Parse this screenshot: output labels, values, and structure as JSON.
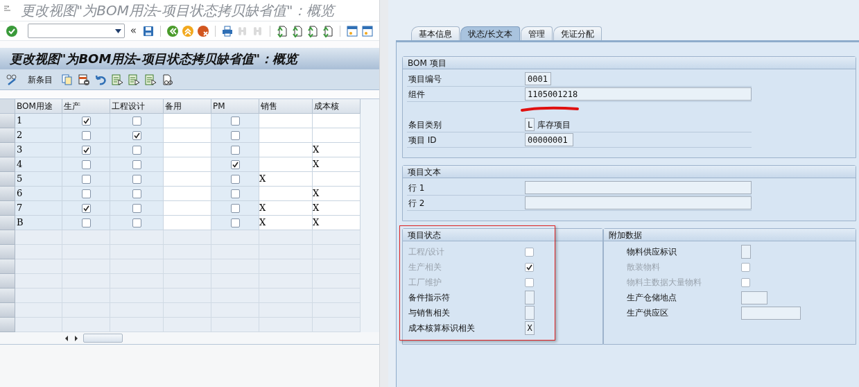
{
  "window": {
    "title": "更改视图\"为BOM用法-项目状态拷贝缺省值\"：概览"
  },
  "toolbar": {
    "back_symbol": "«"
  },
  "header": {
    "title": "更改视图\"为BOM用法-项目状态拷贝缺省值\"：概览"
  },
  "app_toolbar": {
    "new_entries": "新条目"
  },
  "table": {
    "columns": [
      "BOM用途",
      "生产",
      "工程设计",
      "备用",
      "PM",
      "销售",
      "成本核"
    ],
    "rows": [
      {
        "usage": "1",
        "production": true,
        "engineering": false,
        "pm": false,
        "sales": "",
        "costing": ""
      },
      {
        "usage": "2",
        "production": false,
        "engineering": true,
        "pm": false,
        "sales": "",
        "costing": ""
      },
      {
        "usage": "3",
        "production": true,
        "engineering": false,
        "pm": false,
        "sales": "",
        "costing": "X"
      },
      {
        "usage": "4",
        "production": false,
        "engineering": false,
        "pm": true,
        "sales": "",
        "costing": "X"
      },
      {
        "usage": "5",
        "production": false,
        "engineering": false,
        "pm": false,
        "sales": "X",
        "costing": ""
      },
      {
        "usage": "6",
        "production": false,
        "engineering": false,
        "pm": false,
        "sales": "",
        "costing": "X"
      },
      {
        "usage": "7",
        "production": true,
        "engineering": false,
        "pm": false,
        "sales": "X",
        "costing": "X"
      },
      {
        "usage": "B",
        "production": false,
        "engineering": false,
        "pm": false,
        "sales": "X",
        "costing": "X"
      }
    ]
  },
  "tabs": [
    {
      "label": "基本信息",
      "selected": false
    },
    {
      "label": "状态/长文本",
      "selected": true
    },
    {
      "label": "管理",
      "selected": false
    },
    {
      "label": "凭证分配",
      "selected": false
    }
  ],
  "bom_item": {
    "title": "BOM 项目",
    "fields": [
      {
        "kind": "short",
        "label": "项目编号",
        "value": "0001"
      },
      {
        "kind": "long",
        "label": "组件",
        "value": "1105001218"
      },
      {
        "kind": "redacted"
      },
      {
        "kind": "flag",
        "label": "条目类别",
        "value": "L",
        "description": "库存项目"
      },
      {
        "kind": "medium",
        "label": "项目 ID",
        "value": "00000001"
      }
    ]
  },
  "item_text": {
    "title": "项目文本",
    "lines": [
      {
        "label": "行 1"
      },
      {
        "label": "行 2"
      }
    ]
  },
  "item_status": {
    "title": "项目状态",
    "highlighted": true,
    "items": [
      {
        "kind": "checkbox",
        "label": "工程/设计",
        "checked": false,
        "disabled": true
      },
      {
        "kind": "checkbox",
        "label": "生产相关",
        "checked": true,
        "disabled": true
      },
      {
        "kind": "checkbox",
        "label": "工厂维护",
        "checked": false,
        "disabled": true
      },
      {
        "kind": "flag",
        "label": "备件指示符",
        "disabled": false
      },
      {
        "kind": "flag",
        "label": "与销售相关",
        "disabled": false
      },
      {
        "kind": "flag",
        "label": "成本核算标识相关",
        "value": "X",
        "disabled": false
      }
    ]
  },
  "additional_data": {
    "title": "附加数据",
    "items": [
      {
        "kind": "flag",
        "label": "物料供应标识",
        "disabled": false
      },
      {
        "kind": "checkbox",
        "label": "散装物料",
        "checked": false,
        "disabled": true
      },
      {
        "kind": "checkbox",
        "label": "物料主数据大量物料",
        "checked": false,
        "disabled": true
      },
      {
        "kind": "short",
        "label": "生产仓储地点",
        "disabled": false
      },
      {
        "kind": "long",
        "label": "生产供应区",
        "disabled": false
      }
    ]
  }
}
